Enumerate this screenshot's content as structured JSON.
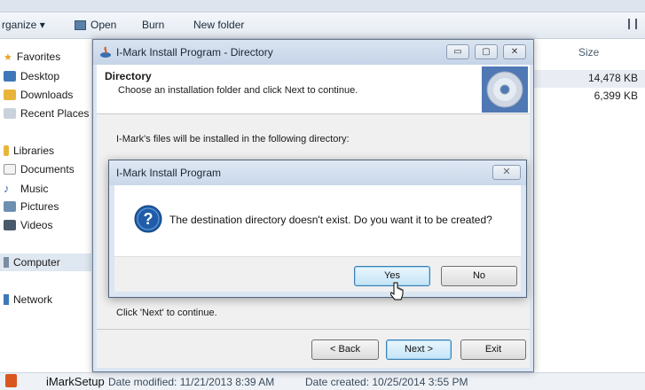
{
  "explorer": {
    "toolbar": {
      "organize_label": "rganize ▾",
      "open_label": "Open",
      "burn_label": "Burn",
      "new_folder_label": "New folder"
    },
    "nav": {
      "favorites": "Favorites",
      "desktop": "Desktop",
      "downloads": "Downloads",
      "recent_places": "Recent Places",
      "libraries": "Libraries",
      "documents": "Documents",
      "music": "Music",
      "pictures": "Pictures",
      "videos": "Videos",
      "computer": "Computer",
      "network": "Network"
    },
    "file_list": {
      "size_header": "Size",
      "sizes": [
        "14,478 KB",
        "6,399 KB"
      ]
    },
    "status": {
      "file_name": "iMarkSetup",
      "date_modified": "Date modified: 11/21/2013 8:39 AM",
      "date_created": "Date created: 10/25/2014 3:55 PM"
    }
  },
  "installer": {
    "title": "I-Mark Install Program - Directory",
    "header_title": "Directory",
    "header_subtitle": "Choose an installation folder and click Next to continue.",
    "body_text": "I-Mark's files will be installed in the following directory:",
    "footer_text": "Click 'Next' to continue.",
    "back_label": "< Back",
    "next_label": "Next >",
    "exit_label": "Exit",
    "minimize_glyph": "▭",
    "maximize_glyph": "▢",
    "close_glyph": "✕"
  },
  "message_box": {
    "title": "I-Mark Install Program",
    "close_glyph": "✕",
    "message": "The destination directory doesn't exist. Do you want it to be created?",
    "yes_label": "Yes",
    "no_label": "No"
  },
  "colors": {
    "accent": "#3c7fb1",
    "question_icon": "#1f5da8",
    "folder_yellow": "#e8b53a"
  }
}
